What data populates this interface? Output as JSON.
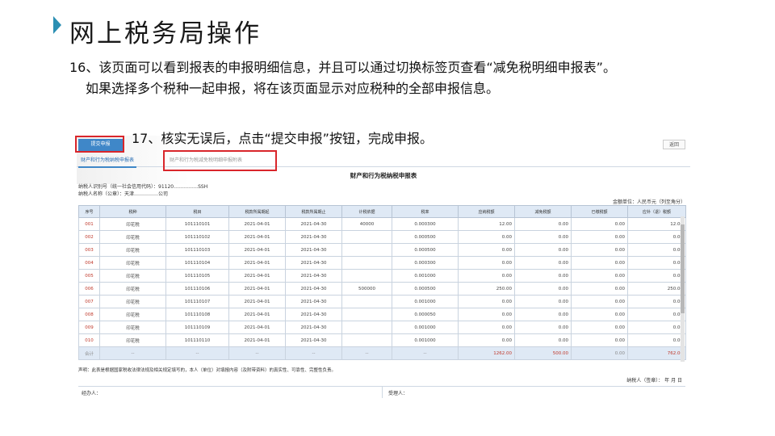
{
  "slide": {
    "title": "网上税务局操作",
    "step16_line1": "16、该页面可以看到报表的申报明细信息，并且可以通过切换标签页查看“减免税明细申报表”。",
    "step16_line2": "如果选择多个税种一起申报，将在该页面显示对应税种的全部申报信息。",
    "step17": "17、核实无误后，点击“提交申报”按钮，完成申报。",
    "accent_color": "#2b8fb3",
    "highlight_color": "#d9262b"
  },
  "screen": {
    "submit_label": "提交申报",
    "return_label": "返回",
    "tabs": [
      "财产和行为税纳税申报表",
      "财产和行为税减免税明细申报附表"
    ],
    "report_title": "财产和行为税纳税申报表",
    "taxpayer_id_line": "纳税人识别号（统一社会信用代码）：91120……………SSH",
    "taxpayer_name_line": "纳税人名称（公章）：天津……………公司",
    "unit_line": "金额单位：人民币元（列至角分）",
    "columns": [
      "序号",
      "税种",
      "税目",
      "税款所属期起",
      "税款所属期止",
      "计税依据",
      "税率",
      "应纳税额",
      "减免税额",
      "已缴税额",
      "应补（退）税额"
    ],
    "rows": [
      [
        "001",
        "印花税",
        "101110101",
        "2021-04-01",
        "2021-04-30",
        "40000",
        "0.000300",
        "12.00",
        "0.00",
        "0.00",
        "12.00"
      ],
      [
        "002",
        "印花税",
        "101110102",
        "2021-04-01",
        "2021-04-30",
        "",
        "0.000500",
        "0.00",
        "0.00",
        "0.00",
        "0.00"
      ],
      [
        "003",
        "印花税",
        "101110103",
        "2021-04-01",
        "2021-04-30",
        "",
        "0.000500",
        "0.00",
        "0.00",
        "0.00",
        "0.00"
      ],
      [
        "004",
        "印花税",
        "101110104",
        "2021-04-01",
        "2021-04-30",
        "",
        "0.000300",
        "0.00",
        "0.00",
        "0.00",
        "0.00"
      ],
      [
        "005",
        "印花税",
        "101110105",
        "2021-04-01",
        "2021-04-30",
        "",
        "0.001000",
        "0.00",
        "0.00",
        "0.00",
        "0.00"
      ],
      [
        "006",
        "印花税",
        "101110106",
        "2021-04-01",
        "2021-04-30",
        "500000",
        "0.000500",
        "250.00",
        "0.00",
        "0.00",
        "250.00"
      ],
      [
        "007",
        "印花税",
        "101110107",
        "2021-04-01",
        "2021-04-30",
        "",
        "0.001000",
        "0.00",
        "0.00",
        "0.00",
        "0.00"
      ],
      [
        "008",
        "印花税",
        "101110108",
        "2021-04-01",
        "2021-04-30",
        "",
        "0.000050",
        "0.00",
        "0.00",
        "0.00",
        "0.00"
      ],
      [
        "009",
        "印花税",
        "101110109",
        "2021-04-01",
        "2021-04-30",
        "",
        "0.001000",
        "0.00",
        "0.00",
        "0.00",
        "0.00"
      ],
      [
        "010",
        "印花税",
        "101110110",
        "2021-04-01",
        "2021-04-30",
        "",
        "0.001000",
        "0.00",
        "0.00",
        "0.00",
        "0.00"
      ]
    ],
    "total_row": [
      "合计",
      "--",
      "--",
      "--",
      "--",
      "--",
      "--",
      "1262.00",
      "500.00",
      "0.00",
      "762.00"
    ],
    "declaration": "声明：此表是根据国家税收法律法规及相关规定填写的，本人（单位）对填报内容（及附带资料）的真实性、可靠性、完整性负责。",
    "sign_line": "纳税人（签章）：    年    月    日",
    "agent_label": "经办人：",
    "receiver_label": "受理人："
  }
}
